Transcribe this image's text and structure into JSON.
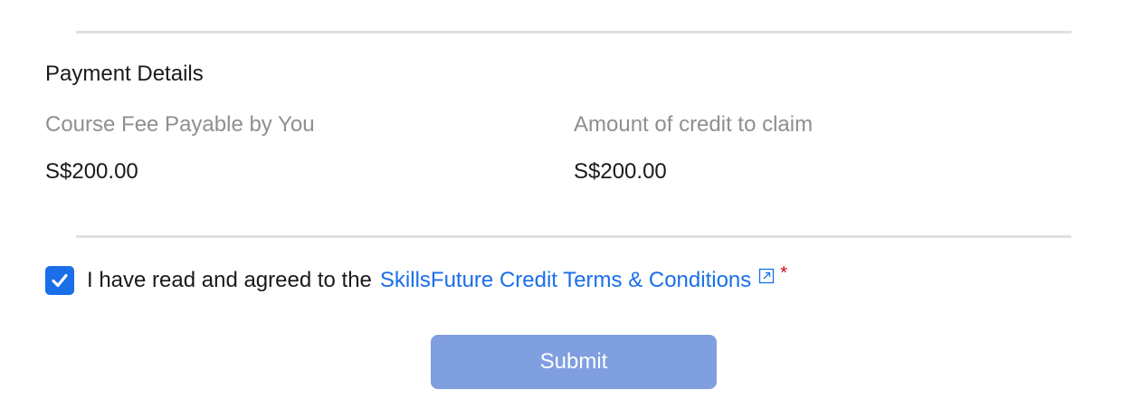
{
  "payment": {
    "title": "Payment Details",
    "fee_label": "Course Fee Payable by You",
    "fee_value": "S$200.00",
    "credit_label": "Amount of credit to claim",
    "credit_value": "S$200.00"
  },
  "agreement": {
    "checked": true,
    "text": "I have read and agreed to the",
    "link_text": "SkillsFuture Credit Terms & Conditions",
    "link_icon": "external-link-icon",
    "required_marker": "*"
  },
  "submit": {
    "label": "Submit",
    "state": "disabled-looking"
  },
  "colors": {
    "link": "#1a6fe8",
    "checkbox": "#1a6fe8",
    "submit_bg": "#7f9fe0",
    "required": "#d0021b",
    "muted_text": "#8f8f8f",
    "divider": "#e0e0e0"
  }
}
